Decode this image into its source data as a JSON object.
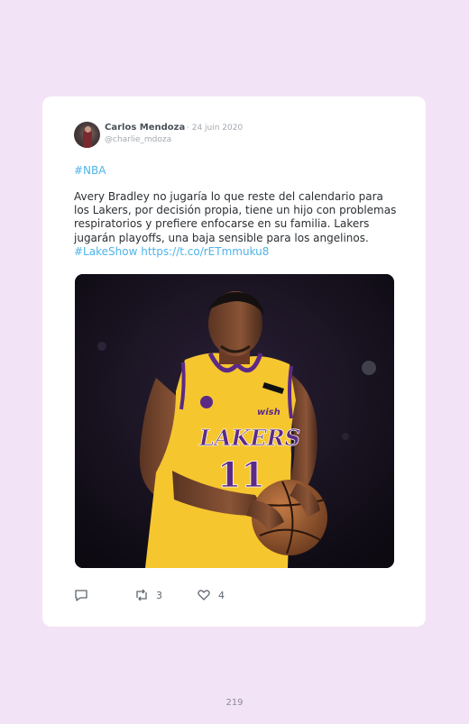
{
  "tweet": {
    "author_name": "Carlos Mendoza",
    "date": "· 24 juin 2020",
    "handle": "@charlie_mdoza",
    "hashtag_line": "#NBA",
    "text": "Avery Bradley no jugaría lo que reste del calendario para los Lakers, por decisión propia, tiene un hijo con problemas respiratorios y prefiere enfocarse en su familia. Lakers jugarán playoffs, una baja sensible para los angelinos.",
    "link_hashtag": "#LakeShow",
    "link_url": "https://t.co/rETmmuku8",
    "image_jersey_text": "LAKERS",
    "image_number": "11",
    "image_sponsor": "wish",
    "retweets": "3",
    "likes": "4"
  },
  "icons": {
    "reply": "reply-icon",
    "retweet": "retweet-icon",
    "like": "heart-icon"
  },
  "page": {
    "number": "219"
  },
  "colors": {
    "background": "#f2e4f6",
    "card": "#ffffff",
    "link": "#4fb3ea",
    "jersey": "#f6c62f",
    "jersey_trim": "#5b2a86"
  }
}
